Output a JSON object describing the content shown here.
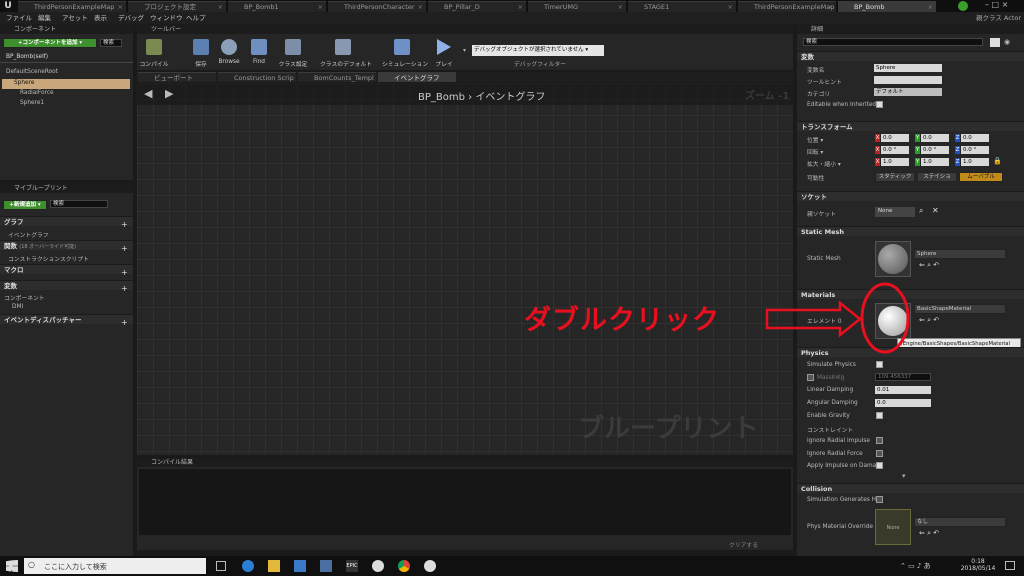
{
  "tabs": [
    "ThirdPersonExampleMap",
    "プロジェクト設定",
    "BP_Bomb1",
    "ThirdPersonCharacter",
    "BP_Pillar_D",
    "TimerUMG",
    "STAGE1",
    "ThirdPersonExampleMap",
    "BP_Bomb"
  ],
  "parent_class": "親クラス Actor",
  "menu": [
    "ファイル",
    "編集",
    "アセット",
    "表示",
    "デバッグ",
    "ウィンドウ",
    "ヘルプ"
  ],
  "components": {
    "title": "コンポーネント",
    "add_button": "+コンポーネントを追加 ▾",
    "search_placeholder": "検索",
    "self": "BP_Bomb(self)",
    "tree": [
      "DefaultSceneRoot",
      "Sphere",
      "RadialForce",
      "Sphere1"
    ]
  },
  "myblueprint": {
    "title": "マイブループリント",
    "add_button": "+新規追加 ▾",
    "search_placeholder": "検索",
    "graph": "グラフ",
    "event_graph": "イベントグラフ",
    "functions": "関数",
    "functions_note": "(18 オーバーライド可能)",
    "construction": "コンストラクションスクリプト",
    "macros": "マクロ",
    "variables": "変数",
    "components": "コンポーネント",
    "dmi": "DMI",
    "dispatchers": "イベントディスパッチャー"
  },
  "toolbar": {
    "title": "ツールバー",
    "items": [
      "コンパイル",
      "保存",
      "Browse",
      "Find",
      "クラス設定",
      "クラスのデフォルト",
      "シミュレーション",
      "プレイ"
    ],
    "debug_select": "デバッグオブジェクトが選択されていません ▾",
    "debug_filter": "デバッグフィルター"
  },
  "graph_tabs": [
    "ビューポート",
    "Construction Scrip",
    "BomCounts_Templ",
    "イベントグラフ"
  ],
  "graph": {
    "breadcrumb": "BP_Bomb",
    "graph_name": "イベントグラフ",
    "zoom": "ズーム -1",
    "watermark": "ブループリント"
  },
  "compile": {
    "title": "コンパイル結果",
    "clear": "クリアする"
  },
  "details": {
    "title": "詳細",
    "search_placeholder": "検索",
    "variable": {
      "header": "変数",
      "name_label": "変数名",
      "name_value": "Sphere",
      "tooltip_label": "ツールヒント",
      "category_label": "カテゴリ",
      "category_value": "デフォルト",
      "editable_label": "Editable when Inherited"
    },
    "transform": {
      "header": "トランスフォーム",
      "location": "位置 ▾",
      "rotation": "回転 ▾",
      "scale": "拡大・縮小 ▾",
      "mobility": "可動性",
      "loc": [
        "0.0",
        "0.0",
        "0.0"
      ],
      "rot": [
        "0.0 °",
        "0.0 °",
        "0.0 °"
      ],
      "scl": [
        "1.0",
        "1.0",
        "1.0"
      ],
      "mob": [
        "スタティック",
        "ステイショ",
        "ムーバブル"
      ]
    },
    "socket": {
      "header": "ソケット",
      "label": "親ソケット",
      "value": "None"
    },
    "static_mesh": {
      "header": "Static Mesh",
      "label": "Static Mesh",
      "value": "Sphere"
    },
    "materials": {
      "header": "Materials",
      "label": "エレメント 0",
      "value": "BasicShapeMaterial",
      "tooltip": "/Engine/BasicShapes/BasicShapeMaterial"
    },
    "physics": {
      "header": "Physics",
      "simulate": "Simulate Physics",
      "mass": "MassInKg",
      "mass_value": "109.456337",
      "linear": "Linear Damping",
      "linear_value": "0.01",
      "angular": "Angular Damping",
      "angular_value": "0.0",
      "gravity": "Enable Gravity",
      "constraint": "コンストレイント",
      "radial_impulse": "Ignore Radial Impulse",
      "radial_force": "Ignore Radial Force",
      "apply_impulse": "Apply Impulse on Damag"
    },
    "collision": {
      "header": "Collision",
      "sim_hit": "Simulation Generates Hit",
      "phys_mat": "Phys Material Override",
      "phys_value": "なし",
      "none": "None"
    }
  },
  "annotation": "ダブルクリック",
  "annotation_color": "#e8101e",
  "taskbar": {
    "search": "ここに入力して検索",
    "time": "0:18",
    "date": "2018/05/14"
  }
}
